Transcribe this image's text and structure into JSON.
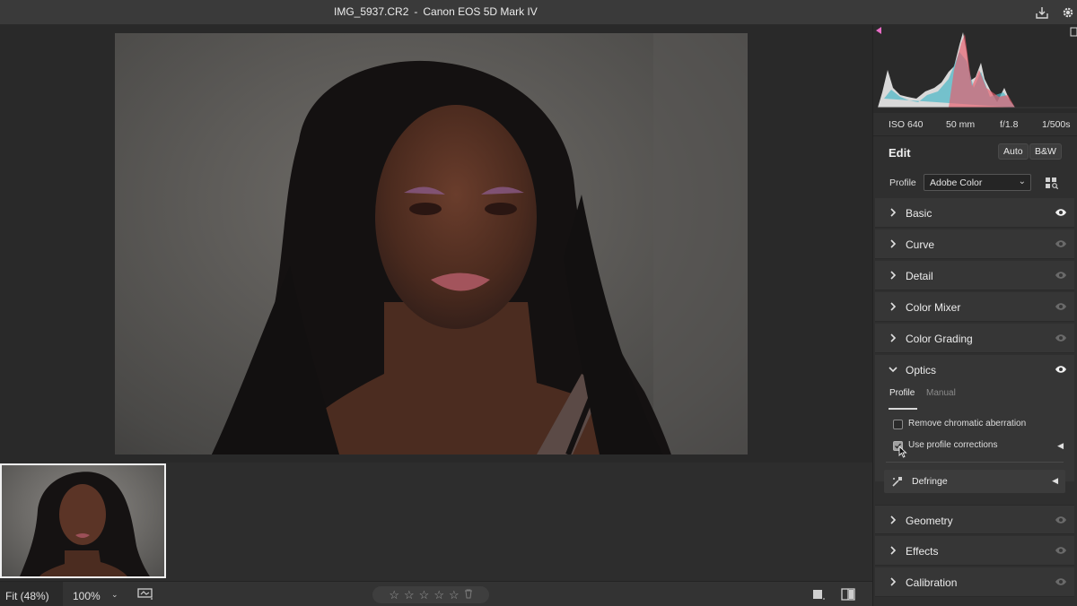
{
  "window": {
    "file_name": "IMG_5937.CR2",
    "separator": "-",
    "camera": "Canon EOS 5D Mark IV"
  },
  "titlebar_icons": [
    "save-icon",
    "gear-icon"
  ],
  "exif": {
    "iso": "ISO 640",
    "focal": "50 mm",
    "aperture": "f/1.8",
    "shutter": "1/500s"
  },
  "edit": {
    "title": "Edit",
    "auto_label": "Auto",
    "bw_label": "B&W",
    "profile_label": "Profile",
    "profile_value": "Adobe Color"
  },
  "sections": [
    {
      "label": "Basic",
      "expanded": false,
      "visible": true
    },
    {
      "label": "Curve",
      "expanded": false,
      "visible": false
    },
    {
      "label": "Detail",
      "expanded": false,
      "visible": false
    },
    {
      "label": "Color Mixer",
      "expanded": false,
      "visible": false
    },
    {
      "label": "Color Grading",
      "expanded": false,
      "visible": false
    },
    {
      "label": "Optics",
      "expanded": true,
      "visible": true
    },
    {
      "label": "Geometry",
      "expanded": false,
      "visible": false
    },
    {
      "label": "Effects",
      "expanded": false,
      "visible": false
    },
    {
      "label": "Calibration",
      "expanded": false,
      "visible": false
    }
  ],
  "optics": {
    "tab_profile": "Profile",
    "tab_manual": "Manual",
    "remove_ca_label": "Remove chromatic aberration",
    "remove_ca_checked": false,
    "profile_corrections_label": "Use profile corrections",
    "profile_corrections_checked": true,
    "defringe_label": "Defringe"
  },
  "bottombar": {
    "fit_label": "Fit (48%)",
    "zoom_label": "100%",
    "rating": 0,
    "stars": [
      "☆",
      "☆",
      "☆",
      "☆",
      "☆"
    ]
  },
  "colors": {
    "panel_bg": "#2f2f2f",
    "section_bg": "#363636",
    "titlebar_bg": "#3a3a3a",
    "accent_pink": "#e86cc6"
  }
}
